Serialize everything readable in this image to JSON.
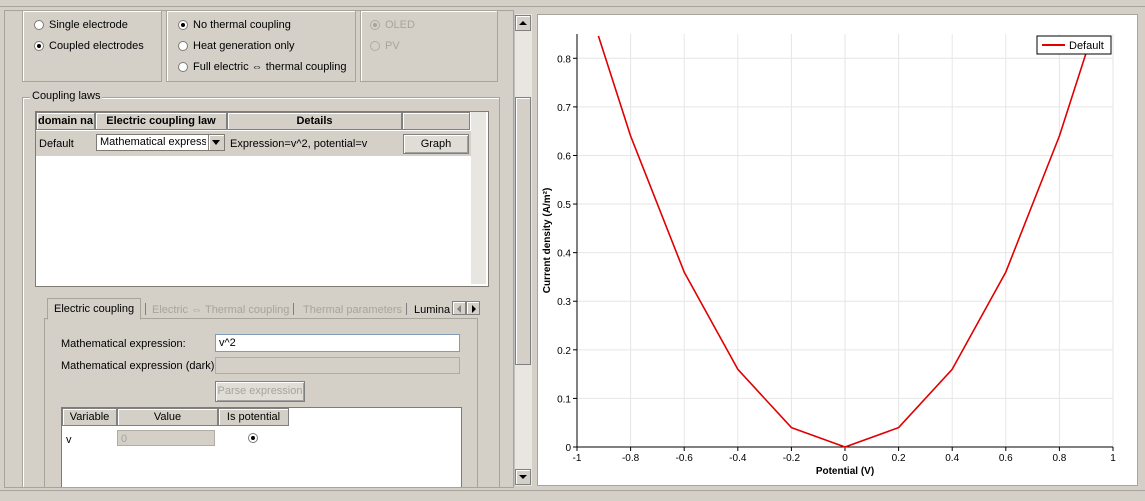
{
  "electrodes": {
    "options": [
      {
        "label": "Single electrode",
        "selected": false
      },
      {
        "label": "Coupled electrodes",
        "selected": true
      }
    ]
  },
  "thermal": {
    "options": [
      {
        "label": "No thermal coupling",
        "selected": true
      },
      {
        "label": "Heat generation only",
        "selected": false
      },
      {
        "label": "Full electric ⇔ thermal coupling",
        "selected": false
      }
    ]
  },
  "device": {
    "options": [
      {
        "label": "OLED",
        "selected": true
      },
      {
        "label": "PV",
        "selected": false
      }
    ]
  },
  "coupling_laws": {
    "group_label": "Coupling laws",
    "headers": [
      "domain na",
      "Electric coupling law",
      "Details",
      ""
    ],
    "row": {
      "domain": "Default",
      "law": "Mathematical expressic",
      "details": "Expression=v^2, potential=v",
      "button": "Graph"
    }
  },
  "tabs": {
    "items": [
      "Electric coupling",
      "Electric ⇔ Thermal coupling",
      "Thermal parameters",
      "Lumina"
    ],
    "active": 0
  },
  "expression": {
    "math_label": "Mathematical expression:",
    "math_value": "v^2",
    "dark_label": "Mathematical expression (dark):",
    "dark_value": "",
    "parse_button": "Parse expression"
  },
  "variables": {
    "headers": [
      "Variable",
      "Value",
      "Is potential"
    ],
    "rows": [
      {
        "variable": "v",
        "value": "0",
        "is_potential": true
      }
    ]
  },
  "chart_data": {
    "type": "line",
    "title": "",
    "xlabel": "Potential (V)",
    "ylabel": "Current density (A/m²)",
    "xlim": [
      -1,
      1
    ],
    "ylim": [
      0,
      0.85
    ],
    "xticks": [
      -1,
      -0.8,
      -0.6,
      -0.4,
      -0.2,
      0,
      0.2,
      0.4,
      0.6,
      0.8,
      1
    ],
    "xtick_labels": [
      "-1",
      "-0.8",
      "-0.6",
      "-0.4",
      "-0.2",
      "0",
      "0.2",
      "0.4",
      "0.6",
      "0.8",
      "1"
    ],
    "yticks": [
      0,
      0.1,
      0.2,
      0.3,
      0.4,
      0.5,
      0.6,
      0.7,
      0.8
    ],
    "ytick_labels": [
      "0",
      "0.1",
      "0.2",
      "0.3",
      "0.4",
      "0.5",
      "0.6",
      "0.7",
      "0.8"
    ],
    "grid": true,
    "legend_position": "top-right",
    "series": [
      {
        "name": "Default",
        "color": "#e00000",
        "x": [
          -0.92,
          -0.8,
          -0.6,
          -0.4,
          -0.2,
          0,
          0.2,
          0.4,
          0.6,
          0.8,
          0.92
        ],
        "y": [
          0.846,
          0.64,
          0.36,
          0.16,
          0.04,
          0,
          0.04,
          0.16,
          0.36,
          0.64,
          0.846
        ]
      }
    ]
  }
}
